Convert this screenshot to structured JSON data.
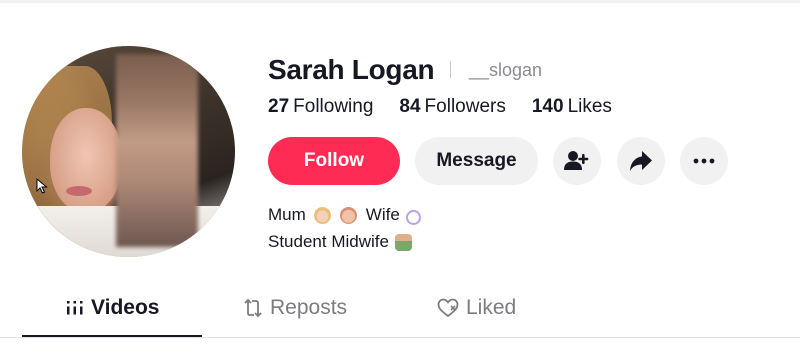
{
  "profile": {
    "display_name": "Sarah Logan",
    "username": "__slogan"
  },
  "stats": [
    {
      "value": "27",
      "label": "Following"
    },
    {
      "value": "84",
      "label": "Followers"
    },
    {
      "value": "140",
      "label": "Likes"
    }
  ],
  "actions": {
    "follow_label": "Follow",
    "message_label": "Message",
    "add_friend_icon": "add-user-icon",
    "share_icon": "share-icon",
    "more_icon": "more-icon"
  },
  "bio": {
    "line1_a": "Mum",
    "line1_b": "Wife",
    "line2": "Student Midwife"
  },
  "tabs": [
    {
      "label": "Videos",
      "icon": "grid-icon",
      "active": true
    },
    {
      "label": "Reposts",
      "icon": "repost-icon",
      "active": false
    },
    {
      "label": "Liked",
      "icon": "heart-icon",
      "active": false
    }
  ],
  "colors": {
    "accent": "#fe2c55",
    "button_bg": "#f1f1f2",
    "text": "#161823",
    "muted": "#8a8b91"
  }
}
